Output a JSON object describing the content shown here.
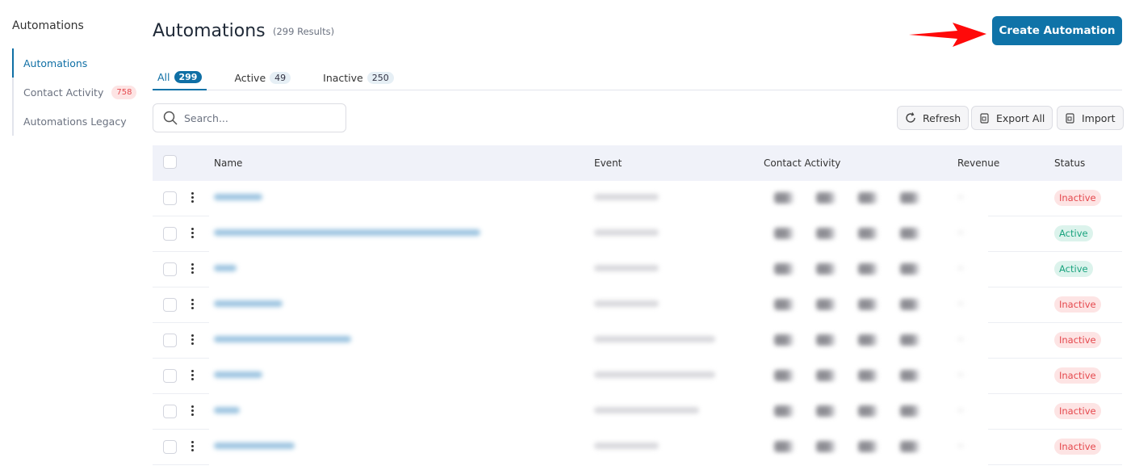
{
  "sidebar": {
    "title": "Automations",
    "items": [
      {
        "label": "Automations"
      },
      {
        "label": "Contact Activity",
        "badge": "758"
      },
      {
        "label": "Automations Legacy"
      }
    ]
  },
  "header": {
    "title": "Automations",
    "results": "(299 Results)",
    "create_label": "Create Automation"
  },
  "tabs": [
    {
      "label": "All",
      "count": "299"
    },
    {
      "label": "Active",
      "count": "49"
    },
    {
      "label": "Inactive",
      "count": "250"
    }
  ],
  "search": {
    "placeholder": "Search..."
  },
  "toolbar": {
    "refresh": "Refresh",
    "export": "Export All",
    "import": "Import"
  },
  "table": {
    "columns": [
      "Name",
      "Event",
      "Contact Activity",
      "Revenue",
      "Status"
    ],
    "rows": [
      {
        "status": "Inactive"
      },
      {
        "status": "Active"
      },
      {
        "status": "Active"
      },
      {
        "status": "Inactive"
      },
      {
        "status": "Inactive"
      },
      {
        "status": "Inactive"
      },
      {
        "status": "Inactive"
      },
      {
        "status": "Inactive"
      }
    ]
  },
  "colors": {
    "accent": "#0f73a8",
    "inactive": "#e5484d",
    "active": "#1aa37e",
    "arrow": "#ff0000"
  }
}
